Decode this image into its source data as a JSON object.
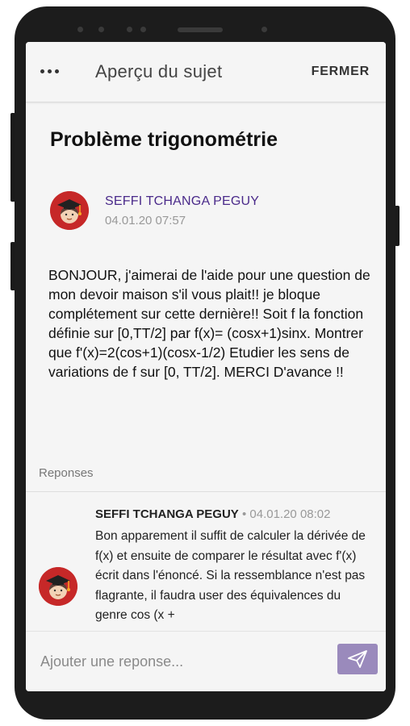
{
  "topbar": {
    "title": "Aperçu du sujet",
    "close_label": "FERMER"
  },
  "subject": {
    "title": "Problème trigonométrie",
    "author": "SEFFI TCHANGA PEGUY",
    "date": "04.01.20 07:57",
    "body": "BONJOUR, j'aimerai de l'aide pour une question de mon devoir maison s'il vous plait!! je bloque complétement sur cette dernière!! Soit f la fonction définie sur [0,TT/2] par f(x)= (cosx+1)sinx. Montrer que f'(x)=2(cos+1)(cosx-1/2) Etudier les sens de variations de f sur [0, TT/2]. MERCI D'avance !!"
  },
  "responses": {
    "label": "Reponses",
    "items": [
      {
        "author": "SEFFI TCHANGA PEGUY",
        "separator": " • ",
        "date": "04.01.20 08:02",
        "text": "Bon apparement il suffit de calculer la dérivée de f(x) et ensuite de comparer le résultat avec f'(x) écrit dans l'énoncé. Si la ressemblance n'est pas flagrante, il faudra user des équivalences du genre cos (x +"
      }
    ]
  },
  "input": {
    "placeholder": "Ajouter une reponse..."
  },
  "colors": {
    "accent": "#9a8abc",
    "author_link": "#4a2a8a",
    "avatar_bg": "#c62828"
  },
  "icons": {
    "menu": "more-horizontal-icon",
    "avatar": "graduate-avatar-icon",
    "send": "paper-plane-icon"
  }
}
